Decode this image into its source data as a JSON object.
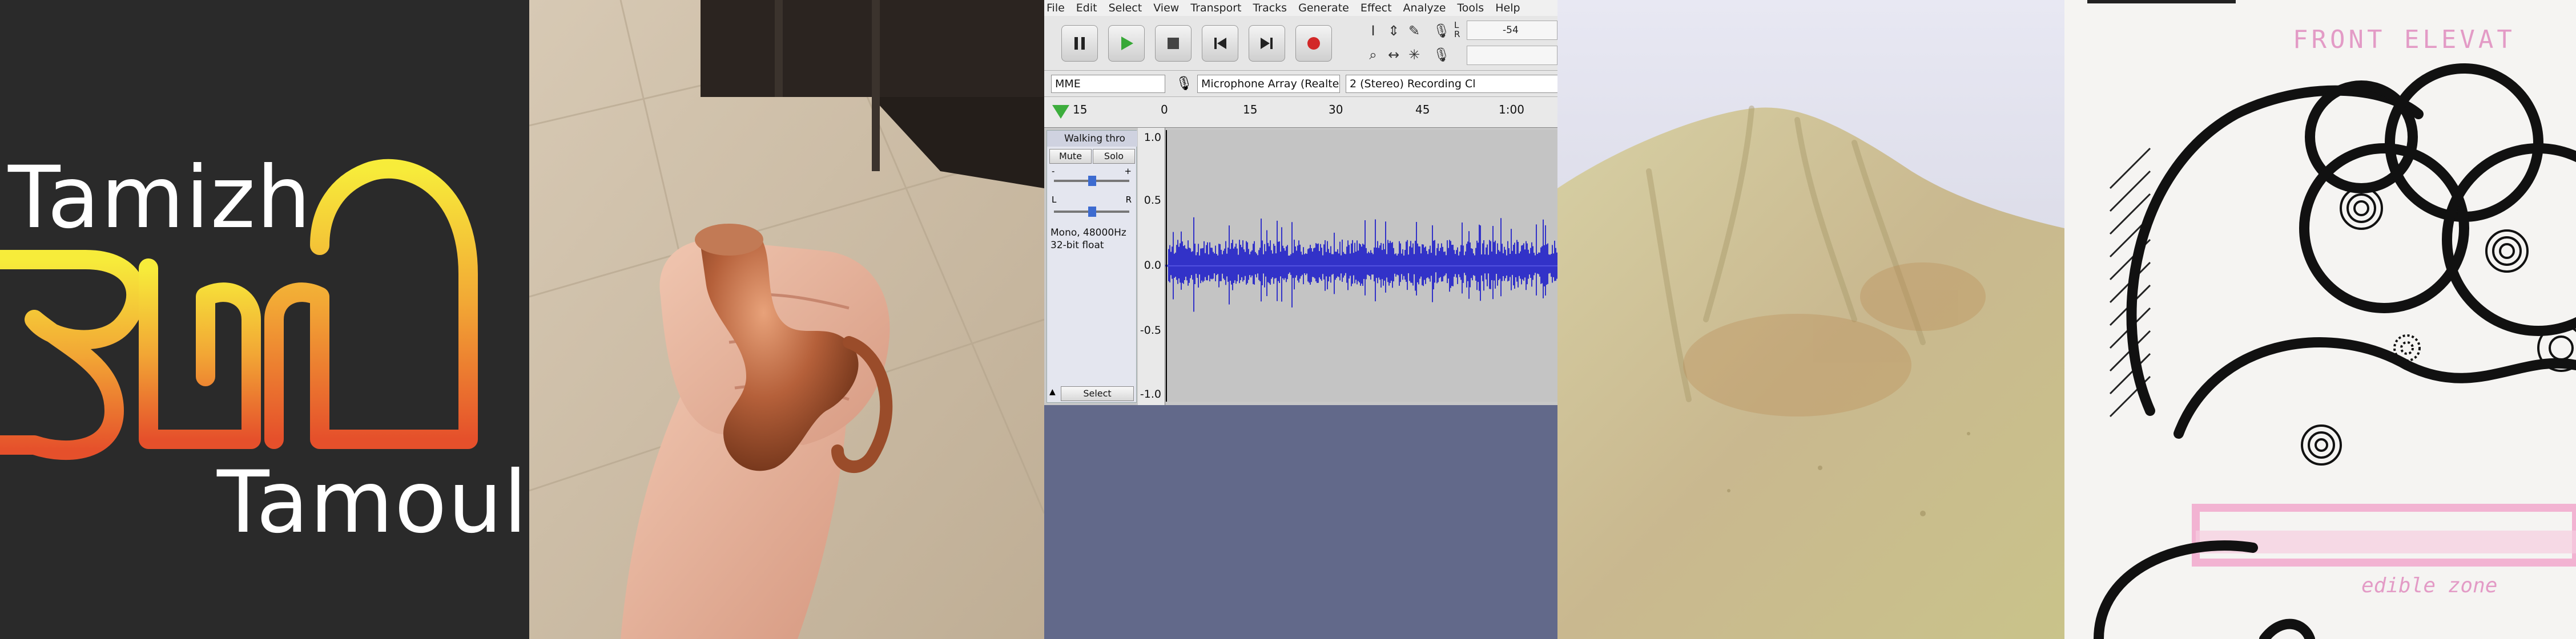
{
  "logo": {
    "word_top": "Tamizh",
    "word_bottom": "Tamoul",
    "glyph_text": "தமி",
    "gradient_colors": [
      "#f7ec3a",
      "#f2a735",
      "#e5502b"
    ]
  },
  "audacity": {
    "menus": [
      "File",
      "Edit",
      "Select",
      "View",
      "Transport",
      "Tracks",
      "Generate",
      "Effect",
      "Analyze",
      "Tools",
      "Help"
    ],
    "transport_buttons": [
      "pause-icon",
      "play-icon",
      "stop-icon",
      "skip-start-icon",
      "skip-end-icon",
      "record-icon"
    ],
    "meter_label": "-54",
    "meter_channels": [
      "L",
      "R"
    ],
    "host": "MME",
    "input_device": "Microphone Array (Realtek(R) Au",
    "channels": "2 (Stereo) Recording Cl",
    "timeline_ticks": [
      "15",
      "0",
      "15",
      "30",
      "45",
      "1:00"
    ],
    "track": {
      "name": "Walking thro",
      "mute_label": "Mute",
      "solo_label": "Solo",
      "gain_labels": [
        "-",
        "+"
      ],
      "pan_labels": [
        "L",
        "R"
      ],
      "info_line1": "Mono, 48000Hz",
      "info_line2": "32-bit float",
      "select_label": "Select"
    },
    "vruler_labels": [
      "1.0",
      "0.5",
      "0.0",
      "-0.5",
      "-1.0"
    ],
    "wave_color": "#3232c8"
  },
  "sketch": {
    "title": "FRONT ELEVAT",
    "caption": "edible zone",
    "ink_pink": "#e39bc6"
  }
}
